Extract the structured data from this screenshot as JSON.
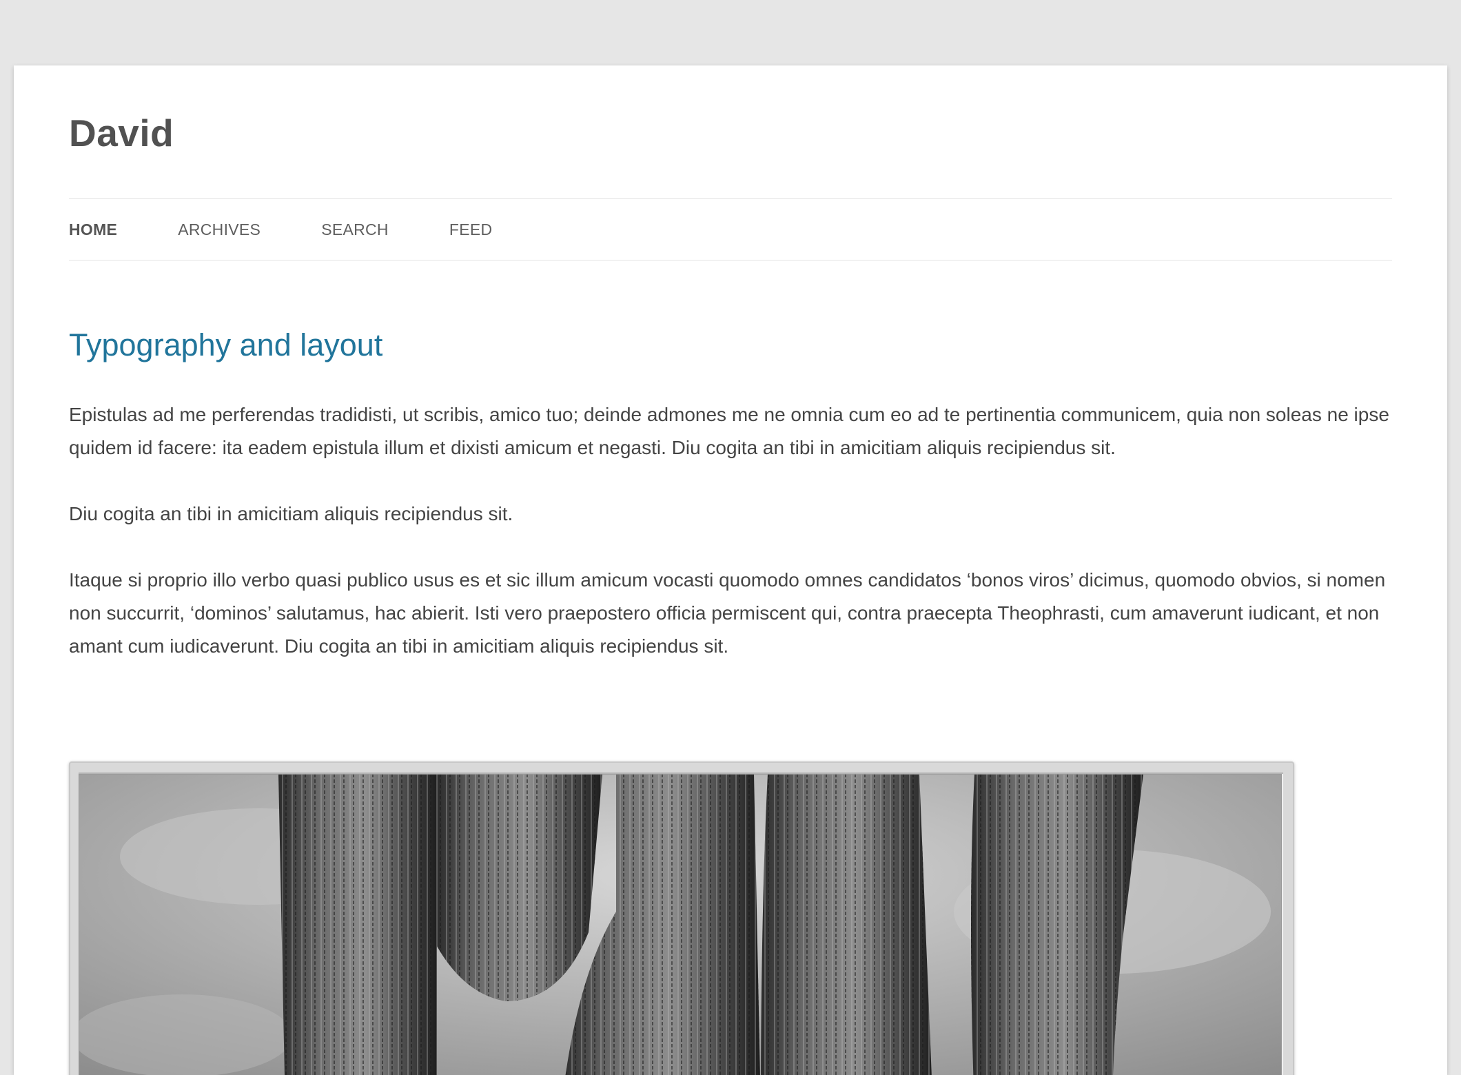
{
  "site": {
    "title": "David"
  },
  "nav": {
    "items": [
      {
        "label": "Home",
        "active": true
      },
      {
        "label": "Archives",
        "active": false
      },
      {
        "label": "Search",
        "active": false
      },
      {
        "label": "Feed",
        "active": false
      }
    ]
  },
  "post": {
    "title": "Typography and layout",
    "paragraphs": [
      "Epistulas ad me perferendas tradidisti, ut scribis, amico tuo; deinde admones me ne omnia cum eo ad te pertinentia communicem, quia non soleas ne ipse quidem id facere: ita eadem epistula illum et dixisti amicum et negasti. Diu cogita an tibi in amicitiam aliquis recipiendus sit.",
      "Diu cogita an tibi in amicitiam aliquis recipiendus sit.",
      "Itaque si proprio illo verbo quasi publico usus es et sic illum amicum vocasti quomodo omnes candidatos ‘bonos viros’ dicimus, quomodo obvios, si nomen non succurrit, ‘dominos’ salutamus, hac abierit. Isti vero praepostero officia permiscent qui, contra praecepta Theophrasti, cum amaverunt iudicant, et non amant cum iudicaverunt. Diu cogita an tibi in amicitiam aliquis recipiendus sit."
    ]
  },
  "colors": {
    "background": "#e6e6e6",
    "link": "#21759b",
    "text": "#444444"
  }
}
